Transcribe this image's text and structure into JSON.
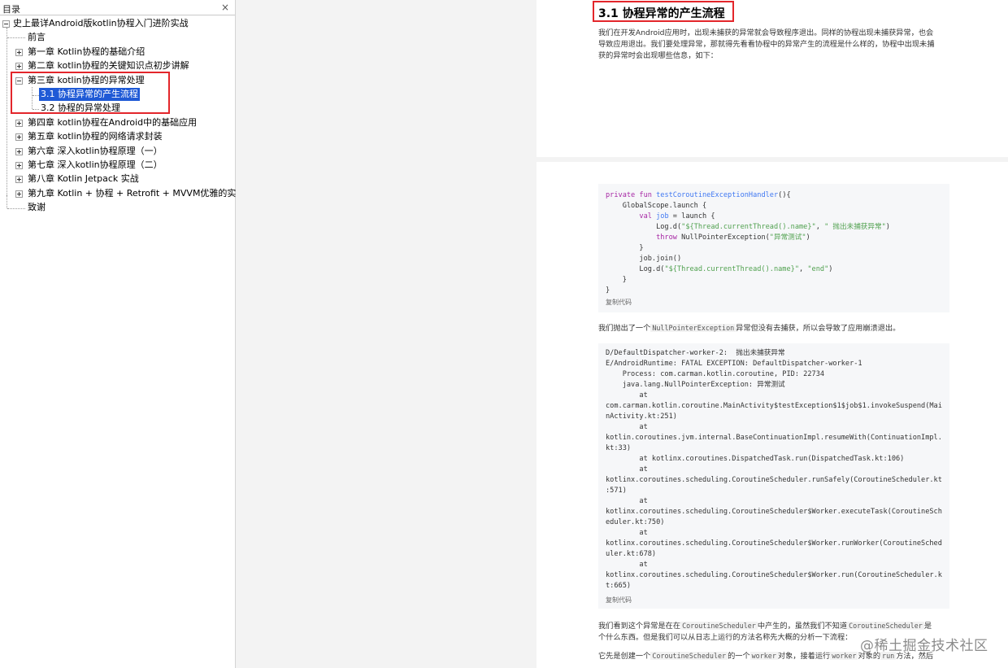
{
  "sidebar": {
    "title": "目录",
    "close": "×",
    "root": "史上最详Android版kotlin协程入门进阶实战",
    "items": [
      "前言",
      "第一章 Kotlin协程的基础介绍",
      "第二章 kotlin协程的关键知识点初步讲解",
      "第三章 kotlin协程的异常处理",
      "3.1 协程异常的产生流程",
      "3.2 协程的异常处理",
      "第四章 kotlin协程在Android中的基础应用",
      "第五章 kotlin协程的网络请求封装",
      "第六章 深入kotlin协程原理（一）",
      "第七章 深入kotlin协程原理（二）",
      "第八章 Kotlin Jetpack 实战",
      "第九章 Kotlin + 协程 + Retrofit + MVVM优雅的实现网络请求",
      "致谢"
    ]
  },
  "document": {
    "heading": "3.1 协程异常的产生流程",
    "intro": [
      "我们在开发Android应用时，出现未捕获的异常就会导致程序退出。同样的协程出现未捕获异常，也会",
      "导致应用退出。我们要处理异常，那就得先看看协程中的异常产生的流程是什么样的，协程中出现未捕",
      "获的异常时会出现哪些信息，如下："
    ],
    "code1": {
      "l1_kw": "private fun ",
      "l1_fn": "testCoroutineExceptionHandler",
      "l1_rest": "(){",
      "l2": "    GlobalScope.launch {",
      "l3_kw": "        val ",
      "l3_fn": "job",
      "l3_rest": " = launch {",
      "l4_a": "            Log.d(",
      "l4_str1": "\"${Thread.currentThread().name}\"",
      "l4_b": ", ",
      "l4_str2": "\" 抛出未捕获异常\"",
      "l4_c": ")",
      "l5_kw": "            throw ",
      "l5_rest": "NullPointerException(",
      "l5_str": "\"异常测试\"",
      "l5_end": ")",
      "l6": "        }",
      "l7": "        job.join()",
      "l8_a": "        Log.d(",
      "l8_str1": "\"${Thread.currentThread().name}\"",
      "l8_b": ", ",
      "l8_str2": "\"end\"",
      "l8_c": ")",
      "l9": "    }",
      "l10": "}",
      "copy": "复制代码"
    },
    "para2_a": "我们抛出了一个",
    "para2_code": "NullPointerException",
    "para2_b": "异常但没有去捕获，所以会导致了应用崩溃退出。",
    "code2": {
      "lines": [
        "D/DefaultDispatcher-worker-2:  抛出未捕获异常",
        "E/AndroidRuntime: FATAL EXCEPTION: DefaultDispatcher-worker-1",
        "    Process: com.carman.kotlin.coroutine, PID: 22734",
        "    java.lang.NullPointerException: 异常测试",
        "        at",
        "com.carman.kotlin.coroutine.MainActivity$testException$1$job$1.invokeSuspend(Mai",
        "nActivity.kt:251)",
        "        at",
        "kotlin.coroutines.jvm.internal.BaseContinuationImpl.resumeWith(ContinuationImpl.",
        "kt:33)",
        "        at kotlinx.coroutines.DispatchedTask.run(DispatchedTask.kt:106)",
        "        at",
        "kotlinx.coroutines.scheduling.CoroutineScheduler.runSafely(CoroutineScheduler.kt",
        ":571)",
        "        at",
        "kotlinx.coroutines.scheduling.CoroutineScheduler$Worker.executeTask(CoroutineSch",
        "eduler.kt:750)",
        "        at",
        "kotlinx.coroutines.scheduling.CoroutineScheduler$Worker.runWorker(CoroutineSched",
        "uler.kt:678)",
        "        at",
        "kotlinx.coroutines.scheduling.CoroutineScheduler$Worker.run(CoroutineScheduler.k",
        "t:665)"
      ],
      "copy": "复制代码"
    },
    "para3": {
      "a": "我们看到这个异常是在在",
      "code1": "CoroutineScheduler",
      "b": "中产生的，虽然我们不知道",
      "code2": "CoroutineScheduler",
      "c": "是",
      "line2": "个什么东西。但是我们可以从日志上运行的方法名称先大概的分析一下流程："
    },
    "para4": {
      "a": "它先是创建一个",
      "code1": "CoroutineScheduler",
      "b": "的一个",
      "code2": "worker",
      "c": "对象，接着运行",
      "code3": "worker",
      "d": "对象的",
      "code4": "run",
      "e": "方法，然后"
    }
  },
  "watermark": "@稀土掘金技术社区",
  "colors": {
    "highlight": "#e3262b",
    "selection": "#1f5ad6",
    "keyword": "#a626a4",
    "function": "#4078f2",
    "string": "#50a14f"
  }
}
